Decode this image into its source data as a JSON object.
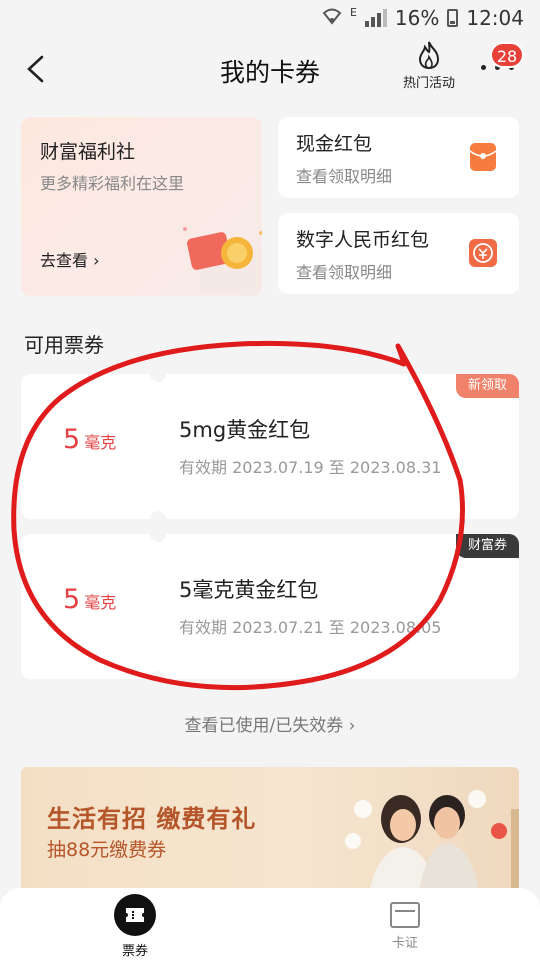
{
  "status_bar": {
    "wifi_icon": "wifi-icon",
    "network": "E",
    "battery": "16%",
    "time": "12:04"
  },
  "header": {
    "title": "我的卡券",
    "hot_label": "热门活动",
    "badge_count": "28"
  },
  "welfare": {
    "title": "财富福利社",
    "subtitle": "更多精彩福利在这里",
    "link": "去查看"
  },
  "red_packets": [
    {
      "title": "现金红包",
      "subtitle": "查看领取明细",
      "icon": "red-envelope-icon"
    },
    {
      "title": "数字人民币红包",
      "subtitle": "查看领取明细",
      "icon": "digital-rmb-icon"
    }
  ],
  "section_title": "可用票券",
  "tickets": [
    {
      "amount": "5",
      "unit": "毫克",
      "name": "5mg黄金红包",
      "validity": "有效期 2023.07.19 至 2023.08.31",
      "tag": "新领取"
    },
    {
      "amount": "5",
      "unit": "毫克",
      "name": "5毫克黄金红包",
      "validity": "有效期 2023.07.21 至 2023.08.05",
      "tag": "财富券"
    }
  ],
  "history_link": "查看已使用/已失效券",
  "banner": {
    "line1": "生活有招 缴费有礼",
    "line2": "抽88元缴费券"
  },
  "tabs": [
    {
      "label": "票券",
      "icon": "ticket-icon",
      "active": true
    },
    {
      "label": "卡证",
      "icon": "card-icon",
      "active": false
    }
  ],
  "colors": {
    "accent_red": "#e34141",
    "annotation_red": "#e01b1b",
    "banner_text": "#b5562a"
  }
}
